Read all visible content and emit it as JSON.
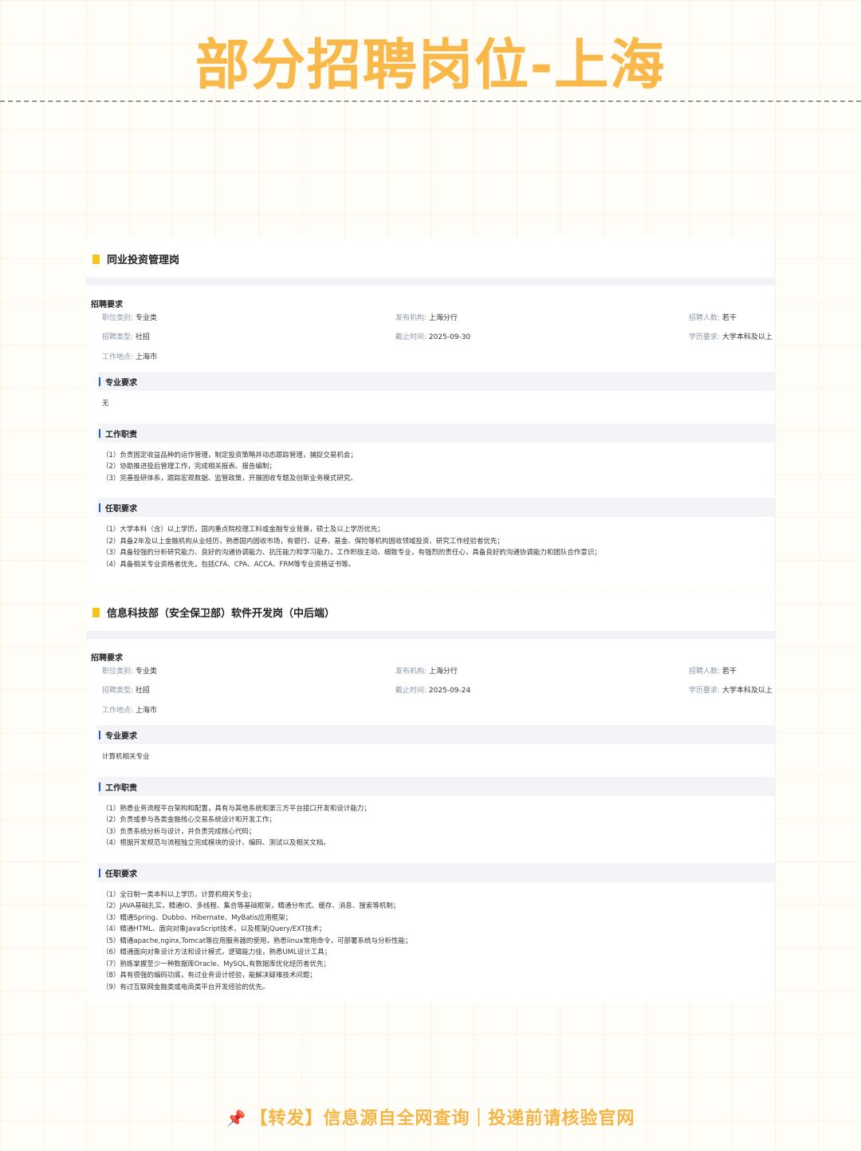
{
  "header": {
    "title": "部分招聘岗位-上海"
  },
  "jobs": [
    {
      "title": "同业投资管理岗",
      "recruit_label": "招聘要求",
      "info": {
        "category_k": "职位类别:",
        "category_v": "专业类",
        "org_k": "发布机构:",
        "org_v": "上海分行",
        "count_k": "招聘人数:",
        "count_v": "若干",
        "type_k": "招聘类型:",
        "type_v": "社招",
        "deadline_k": "截止时间:",
        "deadline_v": "2025-09-30",
        "edu_k": "学历要求:",
        "edu_v": "大学本科及以上",
        "place_k": "工作地点:",
        "place_v": "上海市"
      },
      "major": {
        "label": "专业要求",
        "lines": [
          "无"
        ]
      },
      "duty": {
        "label": "工作职责",
        "lines": [
          "（1）负责固定收益品种的运作管理，制定投资策略并动态跟踪管理，捕捉交易机会；",
          "（2）协助推进投后管理工作，完成相关报表、报告编制；",
          "（3）完善投研体系，跟踪宏观数据、监管政策，开展固收专题及创新业务模式研究。"
        ]
      },
      "req": {
        "label": "任职要求",
        "lines": [
          "（1）大学本科（含）以上学历，国内重点院校理工科或金融专业背景，硕士及以上学历优先；",
          "（2）具备2年及以上金融机构从业经历，熟悉国内固收市场，有银行、证券、基金、保险等机构固收领域投资、研究工作经验者优先；",
          "（3）具备较强的分析研究能力、良好的沟通协调能力、抗压能力和学习能力，工作积极主动、细致专业，有强烈的责任心，具备良好的沟通协调能力和团队合作意识；",
          "（4）具备相关专业资格者优先，包括CFA、CPA、ACCA、FRM等专业资格证书等。"
        ]
      }
    },
    {
      "title": "信息科技部（安全保卫部）软件开发岗（中后端）",
      "recruit_label": "招聘要求",
      "info": {
        "category_k": "职位类别:",
        "category_v": "专业类",
        "org_k": "发布机构:",
        "org_v": "上海分行",
        "count_k": "招聘人数:",
        "count_v": "若干",
        "type_k": "招聘类型:",
        "type_v": "社招",
        "deadline_k": "截止时间:",
        "deadline_v": "2025-09-24",
        "edu_k": "学历要求:",
        "edu_v": "大学本科及以上",
        "place_k": "工作地点:",
        "place_v": "上海市"
      },
      "major": {
        "label": "专业要求",
        "lines": [
          "计算机相关专业"
        ]
      },
      "duty": {
        "label": "工作职责",
        "lines": [
          "（1）熟悉业务流程平台架构和配置，具有与其他系统和第三方平台接口开发和设计能力；",
          "（2）负责或参与各类金融核心交易系统设计和开发工作；",
          "（3）负责系统分析与设计，并负责完成核心代码；",
          "（4）根据开发规范与流程独立完成模块的设计、编码、测试以及相关文档。"
        ]
      },
      "req": {
        "label": "任职要求",
        "lines": [
          "（1）全日制一类本科以上学历，计算机相关专业；",
          "（2）JAVA基础扎实，精通IO、多线程、集合等基础框架，精通分布式、缓存、消息、搜索等机制；",
          "（3）精通Spring、Dubbo、Hibernate、MyBatis应用框架；",
          "（4）精通HTML、面向对象JavaScript技术，以及框架jQuery/EXT技术；",
          "（5）精通apache,nginx,Tomcat等应用服务器的使用，熟悉linux常用命令，可部署系统与分析性能；",
          "（6）精通面向对象设计方法和设计模式，逻辑能力佳，熟悉UML设计工具；",
          "（7）熟练掌握至少一种数据库Oracle、MySQL,有数据库优化经历者优先；",
          "（8）具有很强的编码功底，有过业务设计经验，能解决疑难技术问题；",
          "（9）有过互联网金融类或电商类平台开发经验的优先。"
        ]
      }
    }
  ],
  "footer": {
    "text": "【转发】信息源自全网查询｜投递前请核验官网"
  }
}
